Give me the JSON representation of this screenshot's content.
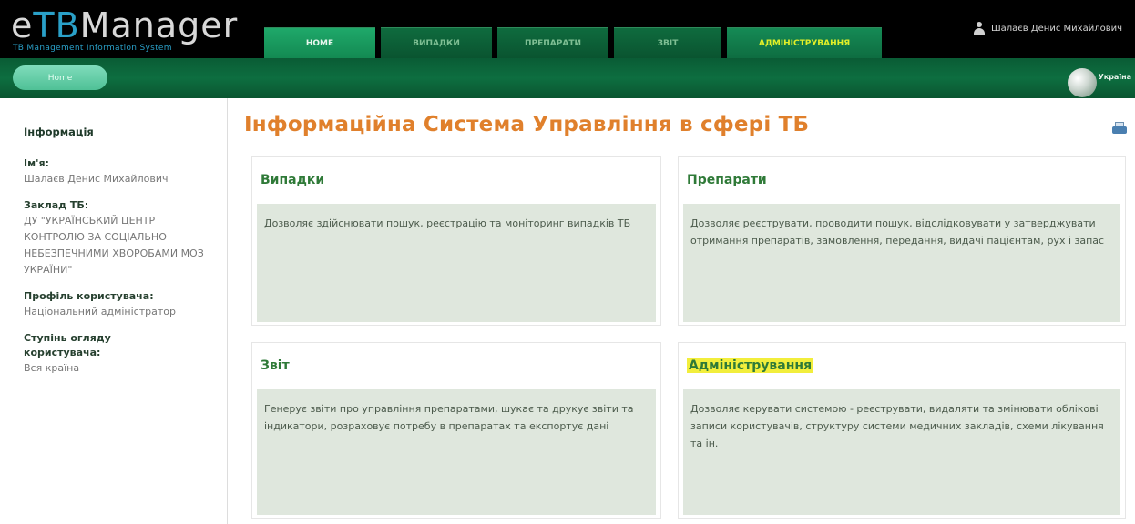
{
  "header": {
    "logo_prefix": "e",
    "logo_accent": "TB",
    "logo_rest": "Manager",
    "logo_subtitle": "TB Management Information System",
    "tabs": [
      {
        "label": "HOME"
      },
      {
        "label": "ВИПАДКИ"
      },
      {
        "label": "ПРЕПАРАТИ"
      },
      {
        "label": "ЗВІТ"
      },
      {
        "label": "АДМІНІСТРУВАННЯ"
      }
    ],
    "user_name": "Шалаєв Денис Михайлович"
  },
  "nav": {
    "home_button": "Home",
    "language": "Україна"
  },
  "sidebar": {
    "heading": "Інформація",
    "fields": [
      {
        "label": "Ім'я:",
        "value": "Шалаєв Денис Михайлович"
      },
      {
        "label": "Заклад ТБ:",
        "value": "ДУ \"УКРАЇНСЬКИЙ ЦЕНТР КОНТРОЛЮ ЗА СОЦІАЛЬНО НЕБЕЗПЕЧНИМИ ХВОРОБАМИ МОЗ УКРАЇНИ\""
      },
      {
        "label": "Профіль користувача:",
        "value": "Національний адміністратор"
      },
      {
        "label": "Ступінь огляду користувача:",
        "value": "Вся країна"
      }
    ]
  },
  "main": {
    "title": "Інформаційна Система Управління в сфері ТБ",
    "cards": [
      {
        "title": "Випадки",
        "text": "Дозволяє здійснювати пошук, реєстрацію та моніторинг випадків ТБ"
      },
      {
        "title": "Препарати",
        "text": "Дозволяє реєструвати, проводити пошук, відслідковувати у затверджувати отримання препаратів, замовлення, передання, видачі пацієнтам, рух і запас"
      },
      {
        "title": "Звіт",
        "text": "Генерує звіти про управління препаратами, шукає та друкує звіти та індикатори, розраховує потребу в препаратах та експортує дані"
      },
      {
        "title": "Адміністрування",
        "text": "Дозволяє керувати системою - реєструвати, видаляти та змінювати облікові записи користувачів, структуру системи медичних закладів, схеми лікування та ін."
      }
    ]
  }
}
